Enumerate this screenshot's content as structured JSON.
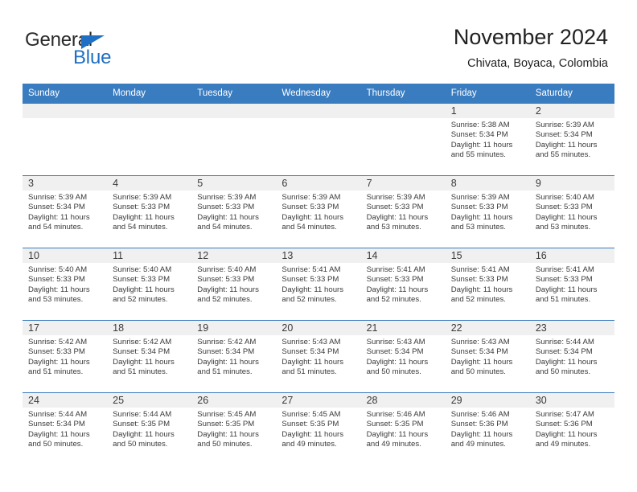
{
  "brand": {
    "name_part1": "General",
    "name_part2": "Blue",
    "triangle_color": "#1f6fc4"
  },
  "header": {
    "title": "November 2024",
    "subtitle": "Chivata, Boyaca, Colombia"
  },
  "theme": {
    "header_blue": "#3a7cc0",
    "daynum_band": "#f0f0f0",
    "text": "#3a3a3a"
  },
  "weekdays": [
    "Sunday",
    "Monday",
    "Tuesday",
    "Wednesday",
    "Thursday",
    "Friday",
    "Saturday"
  ],
  "labels": {
    "sunrise_prefix": "Sunrise:",
    "sunset_prefix": "Sunset:",
    "daylight_prefix": "Daylight:"
  },
  "weeks": [
    [
      {
        "day": "",
        "sunrise": "",
        "sunset": "",
        "daylight_l1": "",
        "daylight_l2": ""
      },
      {
        "day": "",
        "sunrise": "",
        "sunset": "",
        "daylight_l1": "",
        "daylight_l2": ""
      },
      {
        "day": "",
        "sunrise": "",
        "sunset": "",
        "daylight_l1": "",
        "daylight_l2": ""
      },
      {
        "day": "",
        "sunrise": "",
        "sunset": "",
        "daylight_l1": "",
        "daylight_l2": ""
      },
      {
        "day": "",
        "sunrise": "",
        "sunset": "",
        "daylight_l1": "",
        "daylight_l2": ""
      },
      {
        "day": "1",
        "sunrise": "Sunrise: 5:38 AM",
        "sunset": "Sunset: 5:34 PM",
        "daylight_l1": "Daylight: 11 hours",
        "daylight_l2": "and 55 minutes."
      },
      {
        "day": "2",
        "sunrise": "Sunrise: 5:39 AM",
        "sunset": "Sunset: 5:34 PM",
        "daylight_l1": "Daylight: 11 hours",
        "daylight_l2": "and 55 minutes."
      }
    ],
    [
      {
        "day": "3",
        "sunrise": "Sunrise: 5:39 AM",
        "sunset": "Sunset: 5:34 PM",
        "daylight_l1": "Daylight: 11 hours",
        "daylight_l2": "and 54 minutes."
      },
      {
        "day": "4",
        "sunrise": "Sunrise: 5:39 AM",
        "sunset": "Sunset: 5:33 PM",
        "daylight_l1": "Daylight: 11 hours",
        "daylight_l2": "and 54 minutes."
      },
      {
        "day": "5",
        "sunrise": "Sunrise: 5:39 AM",
        "sunset": "Sunset: 5:33 PM",
        "daylight_l1": "Daylight: 11 hours",
        "daylight_l2": "and 54 minutes."
      },
      {
        "day": "6",
        "sunrise": "Sunrise: 5:39 AM",
        "sunset": "Sunset: 5:33 PM",
        "daylight_l1": "Daylight: 11 hours",
        "daylight_l2": "and 54 minutes."
      },
      {
        "day": "7",
        "sunrise": "Sunrise: 5:39 AM",
        "sunset": "Sunset: 5:33 PM",
        "daylight_l1": "Daylight: 11 hours",
        "daylight_l2": "and 53 minutes."
      },
      {
        "day": "8",
        "sunrise": "Sunrise: 5:39 AM",
        "sunset": "Sunset: 5:33 PM",
        "daylight_l1": "Daylight: 11 hours",
        "daylight_l2": "and 53 minutes."
      },
      {
        "day": "9",
        "sunrise": "Sunrise: 5:40 AM",
        "sunset": "Sunset: 5:33 PM",
        "daylight_l1": "Daylight: 11 hours",
        "daylight_l2": "and 53 minutes."
      }
    ],
    [
      {
        "day": "10",
        "sunrise": "Sunrise: 5:40 AM",
        "sunset": "Sunset: 5:33 PM",
        "daylight_l1": "Daylight: 11 hours",
        "daylight_l2": "and 53 minutes."
      },
      {
        "day": "11",
        "sunrise": "Sunrise: 5:40 AM",
        "sunset": "Sunset: 5:33 PM",
        "daylight_l1": "Daylight: 11 hours",
        "daylight_l2": "and 52 minutes."
      },
      {
        "day": "12",
        "sunrise": "Sunrise: 5:40 AM",
        "sunset": "Sunset: 5:33 PM",
        "daylight_l1": "Daylight: 11 hours",
        "daylight_l2": "and 52 minutes."
      },
      {
        "day": "13",
        "sunrise": "Sunrise: 5:41 AM",
        "sunset": "Sunset: 5:33 PM",
        "daylight_l1": "Daylight: 11 hours",
        "daylight_l2": "and 52 minutes."
      },
      {
        "day": "14",
        "sunrise": "Sunrise: 5:41 AM",
        "sunset": "Sunset: 5:33 PM",
        "daylight_l1": "Daylight: 11 hours",
        "daylight_l2": "and 52 minutes."
      },
      {
        "day": "15",
        "sunrise": "Sunrise: 5:41 AM",
        "sunset": "Sunset: 5:33 PM",
        "daylight_l1": "Daylight: 11 hours",
        "daylight_l2": "and 52 minutes."
      },
      {
        "day": "16",
        "sunrise": "Sunrise: 5:41 AM",
        "sunset": "Sunset: 5:33 PM",
        "daylight_l1": "Daylight: 11 hours",
        "daylight_l2": "and 51 minutes."
      }
    ],
    [
      {
        "day": "17",
        "sunrise": "Sunrise: 5:42 AM",
        "sunset": "Sunset: 5:33 PM",
        "daylight_l1": "Daylight: 11 hours",
        "daylight_l2": "and 51 minutes."
      },
      {
        "day": "18",
        "sunrise": "Sunrise: 5:42 AM",
        "sunset": "Sunset: 5:34 PM",
        "daylight_l1": "Daylight: 11 hours",
        "daylight_l2": "and 51 minutes."
      },
      {
        "day": "19",
        "sunrise": "Sunrise: 5:42 AM",
        "sunset": "Sunset: 5:34 PM",
        "daylight_l1": "Daylight: 11 hours",
        "daylight_l2": "and 51 minutes."
      },
      {
        "day": "20",
        "sunrise": "Sunrise: 5:43 AM",
        "sunset": "Sunset: 5:34 PM",
        "daylight_l1": "Daylight: 11 hours",
        "daylight_l2": "and 51 minutes."
      },
      {
        "day": "21",
        "sunrise": "Sunrise: 5:43 AM",
        "sunset": "Sunset: 5:34 PM",
        "daylight_l1": "Daylight: 11 hours",
        "daylight_l2": "and 50 minutes."
      },
      {
        "day": "22",
        "sunrise": "Sunrise: 5:43 AM",
        "sunset": "Sunset: 5:34 PM",
        "daylight_l1": "Daylight: 11 hours",
        "daylight_l2": "and 50 minutes."
      },
      {
        "day": "23",
        "sunrise": "Sunrise: 5:44 AM",
        "sunset": "Sunset: 5:34 PM",
        "daylight_l1": "Daylight: 11 hours",
        "daylight_l2": "and 50 minutes."
      }
    ],
    [
      {
        "day": "24",
        "sunrise": "Sunrise: 5:44 AM",
        "sunset": "Sunset: 5:34 PM",
        "daylight_l1": "Daylight: 11 hours",
        "daylight_l2": "and 50 minutes."
      },
      {
        "day": "25",
        "sunrise": "Sunrise: 5:44 AM",
        "sunset": "Sunset: 5:35 PM",
        "daylight_l1": "Daylight: 11 hours",
        "daylight_l2": "and 50 minutes."
      },
      {
        "day": "26",
        "sunrise": "Sunrise: 5:45 AM",
        "sunset": "Sunset: 5:35 PM",
        "daylight_l1": "Daylight: 11 hours",
        "daylight_l2": "and 50 minutes."
      },
      {
        "day": "27",
        "sunrise": "Sunrise: 5:45 AM",
        "sunset": "Sunset: 5:35 PM",
        "daylight_l1": "Daylight: 11 hours",
        "daylight_l2": "and 49 minutes."
      },
      {
        "day": "28",
        "sunrise": "Sunrise: 5:46 AM",
        "sunset": "Sunset: 5:35 PM",
        "daylight_l1": "Daylight: 11 hours",
        "daylight_l2": "and 49 minutes."
      },
      {
        "day": "29",
        "sunrise": "Sunrise: 5:46 AM",
        "sunset": "Sunset: 5:36 PM",
        "daylight_l1": "Daylight: 11 hours",
        "daylight_l2": "and 49 minutes."
      },
      {
        "day": "30",
        "sunrise": "Sunrise: 5:47 AM",
        "sunset": "Sunset: 5:36 PM",
        "daylight_l1": "Daylight: 11 hours",
        "daylight_l2": "and 49 minutes."
      }
    ]
  ]
}
